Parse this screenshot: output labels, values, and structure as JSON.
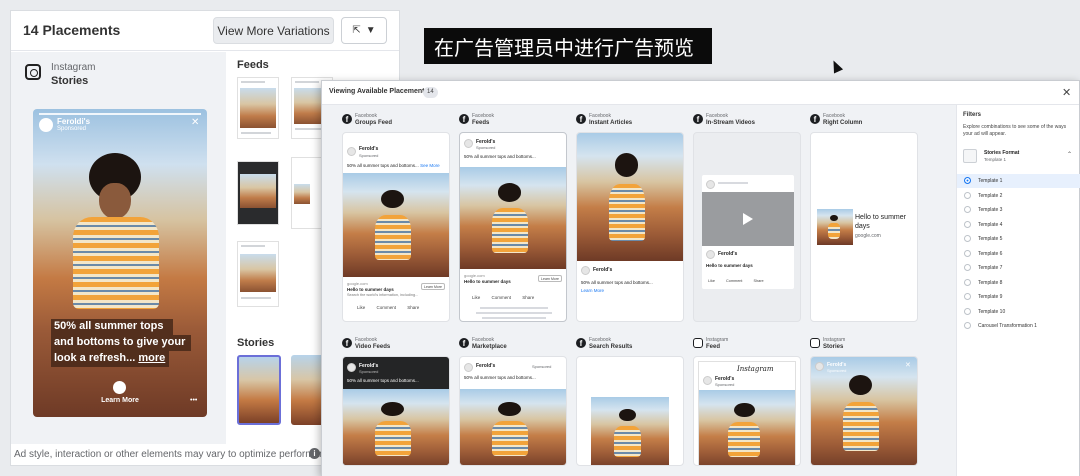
{
  "background": {
    "title": "14 Placements",
    "view_more_label": "View More Variations",
    "selected": {
      "network": "Instagram",
      "placement": "Stories"
    },
    "feeds_label": "Feeds",
    "stories_label": "Stories",
    "story": {
      "brand": "Feroldi's",
      "sponsored": "Sponsored",
      "caption_1": "50% all summer tops",
      "caption_2": "and bottoms to give your",
      "caption_3_prefix": "look a refresh... ",
      "caption_more": "more",
      "cta": "Learn More",
      "dots": "•••"
    },
    "footer": "Ad style, interaction or other elements may vary to optimize performance."
  },
  "overlay_label": "在广告管理员中进行广告预览",
  "modal": {
    "title": "Viewing Available Placements",
    "count": "14",
    "close": "✕",
    "placements": [
      {
        "network": "Facebook",
        "name": "Groups Feed"
      },
      {
        "network": "Facebook",
        "name": "Feeds"
      },
      {
        "network": "Facebook",
        "name": "Instant Articles"
      },
      {
        "network": "Facebook",
        "name": "In-Stream Videos"
      },
      {
        "network": "Facebook",
        "name": "Right Column"
      },
      {
        "network": "Facebook",
        "name": "Video Feeds"
      },
      {
        "network": "Facebook",
        "name": "Marketplace"
      },
      {
        "network": "Facebook",
        "name": "Search Results"
      },
      {
        "network": "Instagram",
        "name": "Feed"
      },
      {
        "network": "Instagram",
        "name": "Stories"
      }
    ],
    "ad": {
      "brand": "Ferold's",
      "sponsored": "Sponsored",
      "body": "50% all summer tops and bottoms to give your look a refresh",
      "body_short": "50% all summer tops and bottoms...",
      "see_more": "See More",
      "link_headline": "Hello to summer days",
      "link_desc": "Search the world's information, including...",
      "cta": "Learn More",
      "actions": "Like Comment Share",
      "right_column_headline": "Hello to summer days",
      "right_column_url": "google.com",
      "instagram_logo": "Instagram"
    }
  },
  "filters": {
    "title": "Filters",
    "description": "Explore combinations to see some of the ways your ad will appear.",
    "format_label": "Stories Format",
    "format_value": "Template 1",
    "templates": [
      "Template 1",
      "Template 2",
      "Template 3",
      "Template 4",
      "Template 5",
      "Template 6",
      "Template 7",
      "Template 8",
      "Template 9",
      "Template 10",
      "Carousel Transformation 1"
    ],
    "selected_index": 0
  },
  "colors": {
    "accent": "#1877f2",
    "overlay_bg": "#0b0b0b",
    "panel_bg": "#f0f2f5"
  }
}
